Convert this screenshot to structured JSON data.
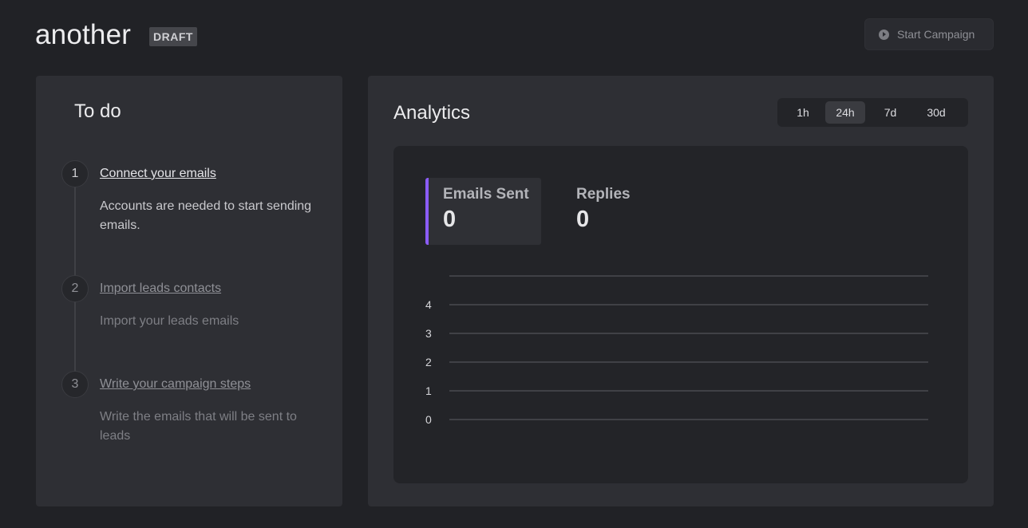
{
  "campaign": {
    "name": "another",
    "status": "DRAFT",
    "start_label": "Start Campaign"
  },
  "todo": {
    "title": "To do",
    "steps": [
      {
        "number": "1",
        "title": "Connect your emails",
        "description": "Accounts are needed to start sending emails."
      },
      {
        "number": "2",
        "title": "Import leads contacts",
        "description": "Import your leads emails"
      },
      {
        "number": "3",
        "title": "Write your campaign steps",
        "description": "Write the emails that will be sent to leads"
      }
    ]
  },
  "analytics": {
    "title": "Analytics",
    "ranges": [
      "1h",
      "24h",
      "7d",
      "30d"
    ],
    "selected_range": "24h",
    "metrics": [
      {
        "label": "Emails Sent",
        "value": "0"
      },
      {
        "label": "Replies",
        "value": "0"
      }
    ],
    "accent_color": "#8b5cf6"
  },
  "chart_data": {
    "type": "line",
    "series": [],
    "ylim": [
      0,
      5
    ],
    "yticks": [
      "0",
      "1",
      "2",
      "3",
      "4"
    ],
    "grid": true
  }
}
